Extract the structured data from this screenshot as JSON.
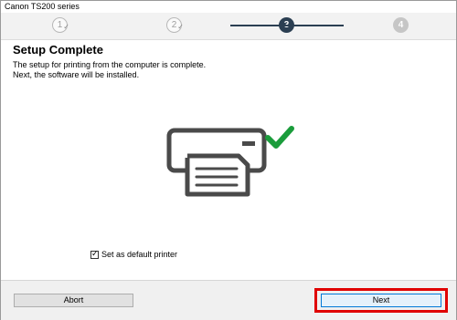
{
  "window": {
    "title": "Canon TS200 series"
  },
  "steps": [
    {
      "label": "1",
      "state": "done"
    },
    {
      "label": "2",
      "state": "done"
    },
    {
      "label": "3",
      "state": "current"
    },
    {
      "label": "4",
      "state": "future"
    }
  ],
  "content": {
    "heading": "Setup Complete",
    "line1": "The setup for printing from the computer is complete.",
    "line2": "Next, the software will be installed.",
    "illustration": "printer-icon",
    "status_icon": "check-icon",
    "check_color": "#1a9c3b"
  },
  "options": {
    "default_printer_label": "Set as default printer",
    "default_printer_checked": true
  },
  "buttons": {
    "abort": "Abort",
    "next": "Next"
  },
  "colors": {
    "accent": "#2b3f52",
    "highlight": "#e00000"
  }
}
